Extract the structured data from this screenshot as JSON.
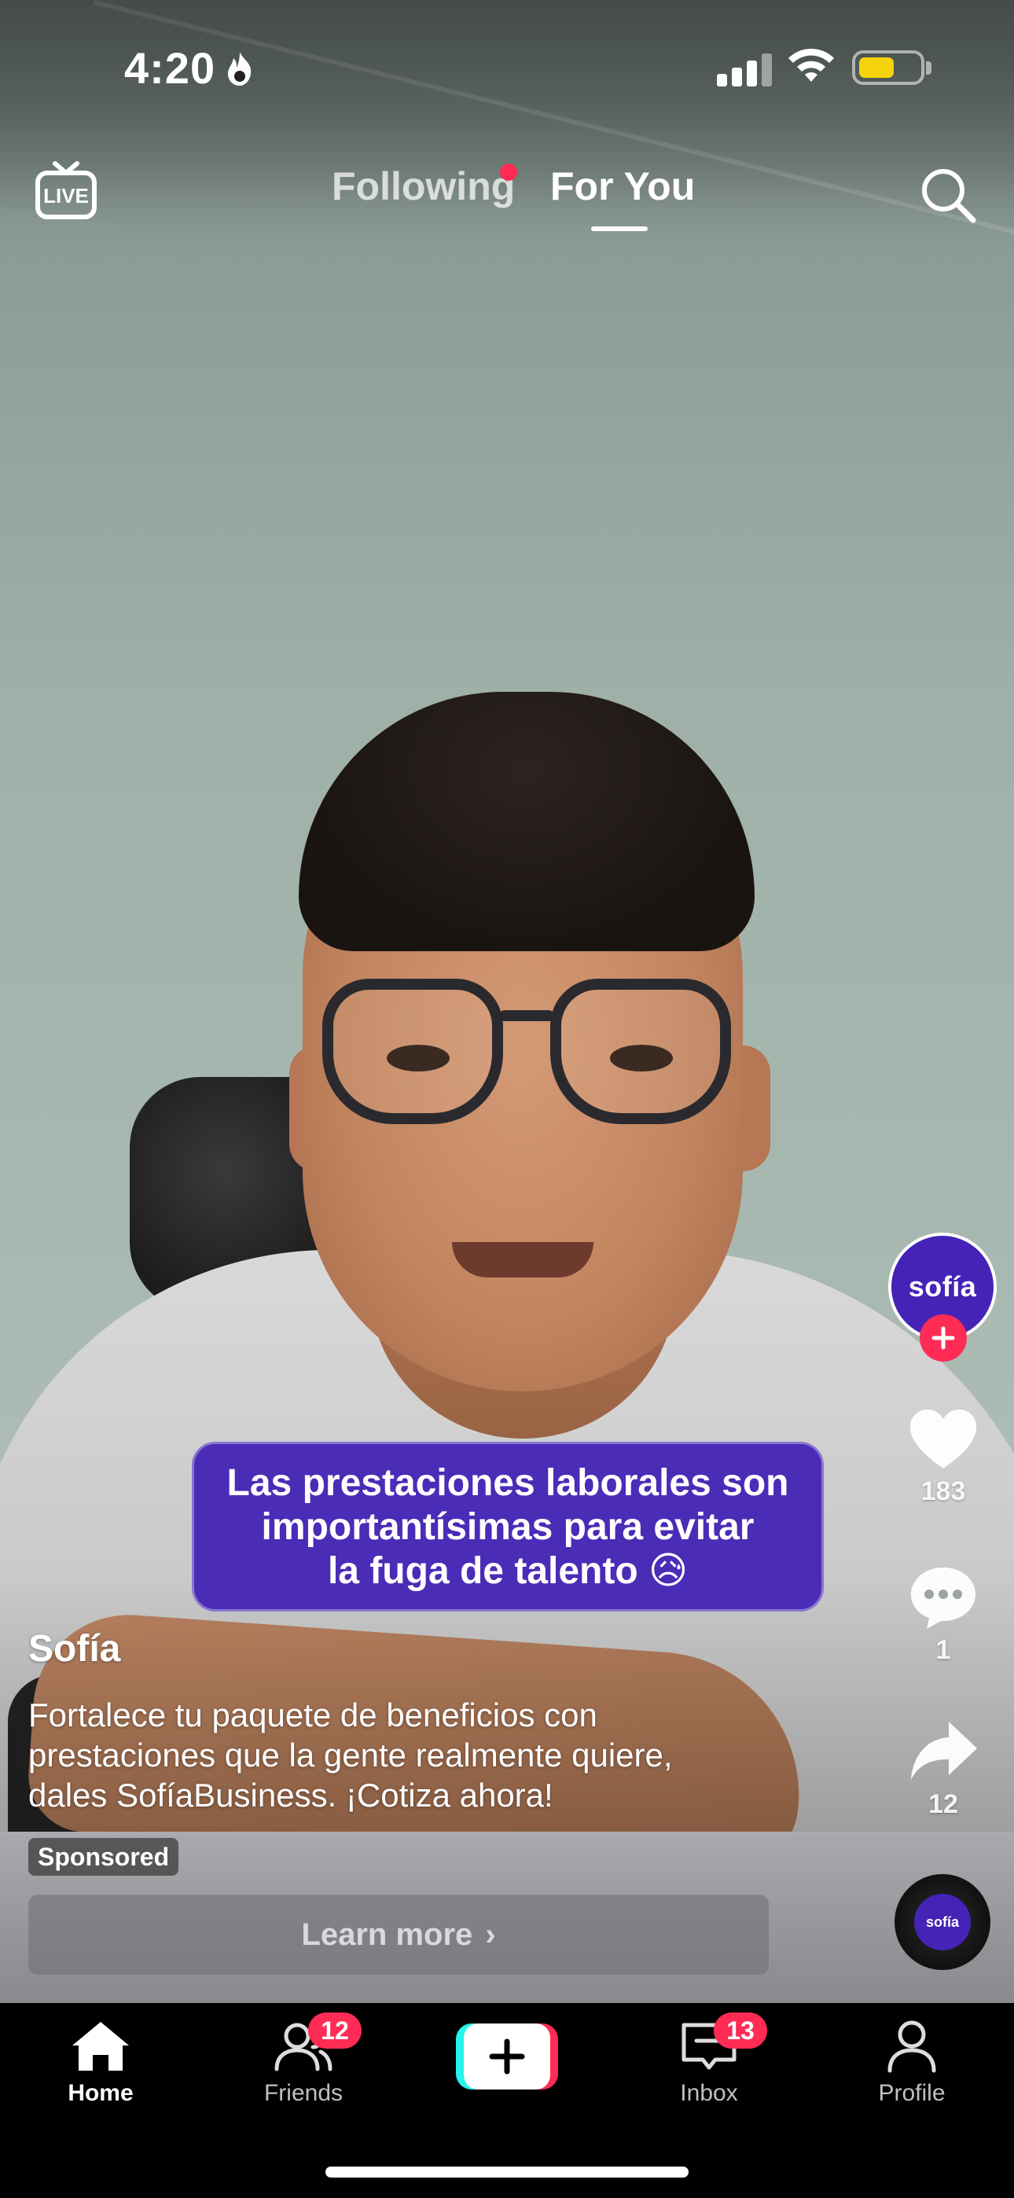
{
  "status_bar": {
    "time": "4:20",
    "battery_level": 0.6,
    "battery_color": "#f6d40b"
  },
  "top_nav": {
    "tabs": [
      {
        "label": "Following",
        "active": false,
        "has_dot": true
      },
      {
        "label": "For You",
        "active": true
      }
    ],
    "live_icon": "live-tv-icon",
    "live_label": "LIVE",
    "search_icon": "search-icon",
    "dot_color": "#fe2c55"
  },
  "creator": {
    "avatar_text": "sofía",
    "avatar_color": "#4423b6"
  },
  "actions": {
    "likes": "183",
    "comments": "1",
    "shares": "12"
  },
  "video_caption": {
    "lines": [
      "Las prestaciones laborales son",
      "importantísimas para evitar",
      "la fuga de talento 😥"
    ],
    "bubble_color": "#4a2cb7"
  },
  "post": {
    "author": "Sofía",
    "description_lines": [
      "Fortalece tu paquete de beneficios con",
      "prestaciones que la gente realmente quiere,",
      "dales SofíaBusiness. ¡Cotiza ahora!"
    ],
    "sponsored_label": "Sponsored",
    "cta_label": "Learn more",
    "cta_chevron": "›",
    "music_disc_text": "sofía"
  },
  "tab_bar": {
    "items": [
      {
        "label": "Home",
        "icon": "home-icon",
        "active": true
      },
      {
        "label": "Friends",
        "icon": "friends-icon",
        "badge": "12"
      },
      {
        "label": "",
        "icon": "create-plus-icon"
      },
      {
        "label": "Inbox",
        "icon": "inbox-icon",
        "badge": "13"
      },
      {
        "label": "Profile",
        "icon": "profile-icon"
      }
    ],
    "accent_colors": [
      "#25f4ee",
      "#fe2c55"
    ]
  }
}
